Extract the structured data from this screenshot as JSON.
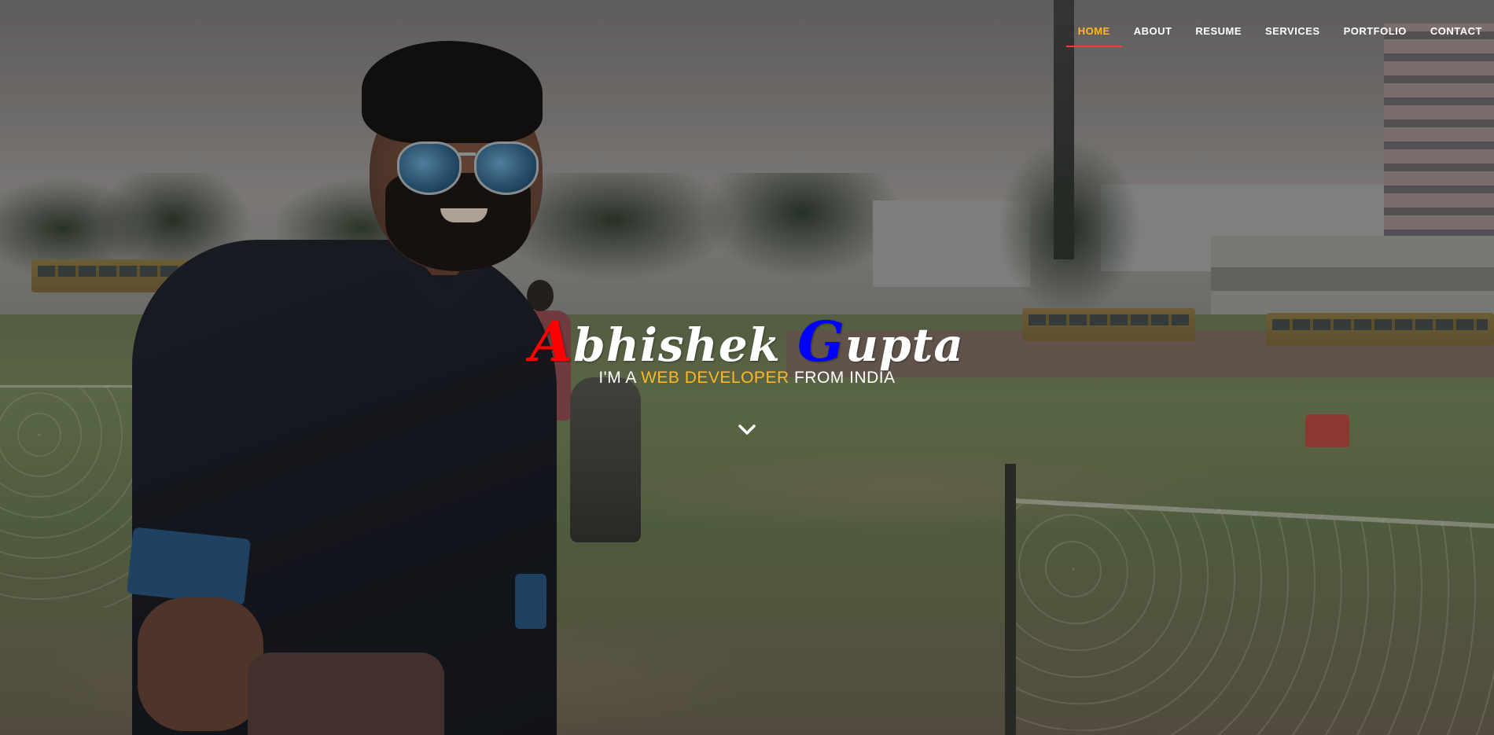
{
  "nav": {
    "items": [
      {
        "label": "HOME",
        "active": true
      },
      {
        "label": "ABOUT",
        "active": false
      },
      {
        "label": "RESUME",
        "active": false
      },
      {
        "label": "SERVICES",
        "active": false
      },
      {
        "label": "PORTFOLIO",
        "active": false
      },
      {
        "label": "CONTACT",
        "active": false
      }
    ]
  },
  "hero": {
    "name_first_initial": "A",
    "name_first_rest": "bhishek",
    "name_last_initial": "G",
    "name_last_rest": "upta",
    "tagline_prefix": "I'M A",
    "tagline_highlight": "WEB DEVELOPER",
    "tagline_suffix": "FROM INDIA",
    "scroll_icon": "chevron-down-icon"
  },
  "colors": {
    "accent": "#ffb727",
    "nav_underline": "#ff3838",
    "name_initial_first": "#ff0000",
    "name_initial_last": "#0000ff",
    "text": "#ffffff"
  }
}
